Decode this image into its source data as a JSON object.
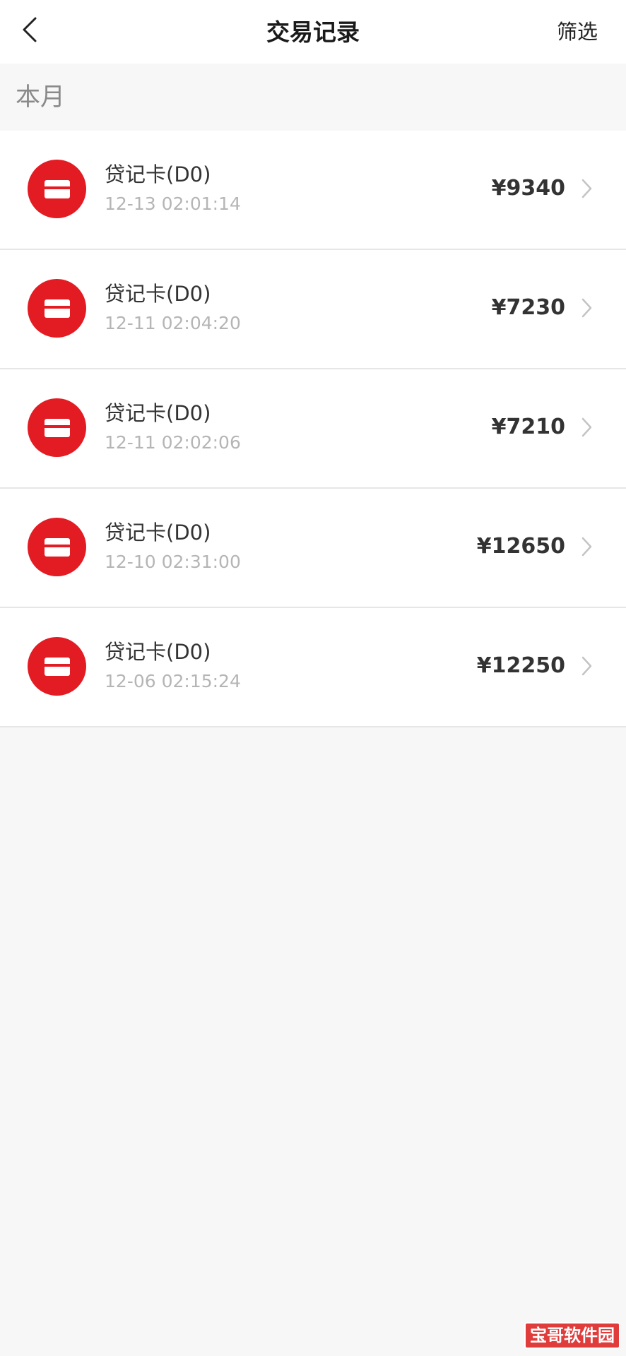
{
  "header": {
    "back_icon": "chevron-left-icon",
    "title": "交易记录",
    "filter_label": "筛选"
  },
  "section": {
    "label": "本月"
  },
  "transactions": [
    {
      "title": "贷记卡(D0)",
      "time": "12-13 02:01:14",
      "amount": "¥9340"
    },
    {
      "title": "贷记卡(D0)",
      "time": "12-11 02:04:20",
      "amount": "¥7230"
    },
    {
      "title": "贷记卡(D0)",
      "time": "12-11 02:02:06",
      "amount": "¥7210"
    },
    {
      "title": "贷记卡(D0)",
      "time": "12-10 02:31:00",
      "amount": "¥12650"
    },
    {
      "title": "贷记卡(D0)",
      "time": "12-06 02:15:24",
      "amount": "¥12250"
    }
  ],
  "icons": {
    "card_icon": "credit-card-icon",
    "row_arrow": "chevron-right-icon"
  },
  "colors": {
    "accent": "#e31b23",
    "page_background": "#f7f7f7",
    "secondary_text": "#b5b5b5"
  },
  "watermark": {
    "text": "宝哥软件园"
  }
}
